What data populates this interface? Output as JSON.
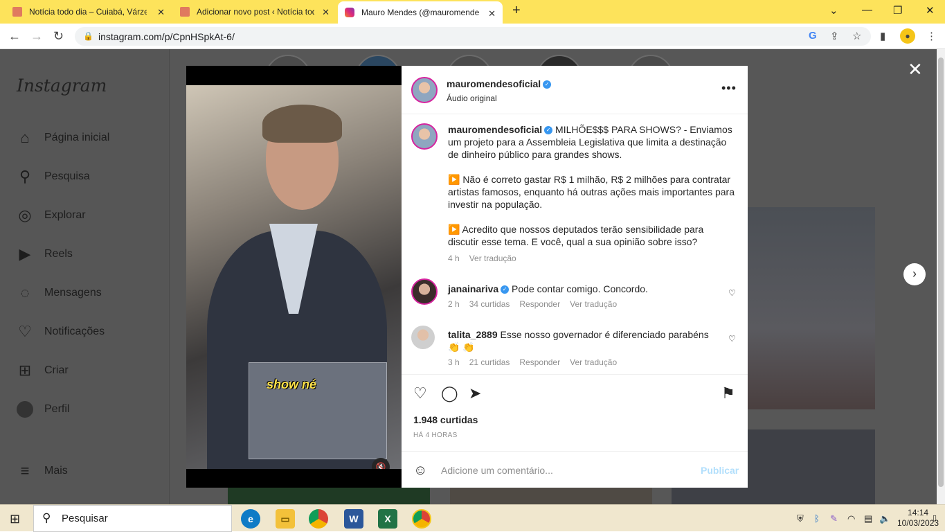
{
  "browser": {
    "tabs": [
      {
        "title": "Notícia todo dia – Cuiabá, Várzea",
        "active": false
      },
      {
        "title": "Adicionar novo post ‹ Notícia todo",
        "active": false
      },
      {
        "title": "Mauro Mendes (@mauromendes",
        "active": true
      }
    ],
    "new_tab": "+",
    "url": "instagram.com/p/CpnHSpkAt-6/"
  },
  "instagram": {
    "logo": "Instagram",
    "nav": [
      {
        "label": "Página inicial",
        "icon": "home-icon"
      },
      {
        "label": "Pesquisa",
        "icon": "search-icon"
      },
      {
        "label": "Explorar",
        "icon": "compass-icon"
      },
      {
        "label": "Reels",
        "icon": "reels-icon"
      },
      {
        "label": "Mensagens",
        "icon": "messenger-icon"
      },
      {
        "label": "Notificações",
        "icon": "heart-icon"
      },
      {
        "label": "Criar",
        "icon": "plus-square-icon"
      },
      {
        "label": "Perfil",
        "icon": "profile-avatar"
      },
      {
        "label": "Mais",
        "icon": "menu-icon"
      }
    ]
  },
  "post": {
    "username": "mauromendesoficial",
    "audio": "Áudio original",
    "video_caption": "show né",
    "caption_lines": [
      "MILHÕE$$$ PARA SHOWS? - Enviamos um projeto para a Assembleia Legislativa que limita a destinação de dinheiro público para grandes shows.",
      "▶️ Não é correto gastar R$ 1 milhão, R$ 2 milhões para contratar artistas famosos, enquanto há outras ações mais importantes para investir na população.",
      "▶️ Acredito que nossos deputados terão sensibilidade para discutir esse tema. E você, qual a sua opinião sobre isso?"
    ],
    "caption_time": "4 h",
    "see_translation": "Ver tradução",
    "comments": [
      {
        "user": "janainariva",
        "text": "Pode contar comigo. Concordo.",
        "time": "2 h",
        "likes": "34 curtidas",
        "reply": "Responder",
        "translate": "Ver tradução"
      },
      {
        "user": "talita_2889",
        "text": "Esse nosso governador é diferenciado parabéns 👏 👏",
        "time": "3 h",
        "likes": "21 curtidas",
        "reply": "Responder",
        "translate": "Ver tradução"
      }
    ],
    "likes": "1.948 curtidas",
    "posted_ago": "HÁ 4 HORAS",
    "comment_placeholder": "Adicione um comentário...",
    "publish": "Publicar"
  },
  "taskbar": {
    "search": "Pesquisar",
    "time": "14:14",
    "date": "10/03/2023"
  }
}
